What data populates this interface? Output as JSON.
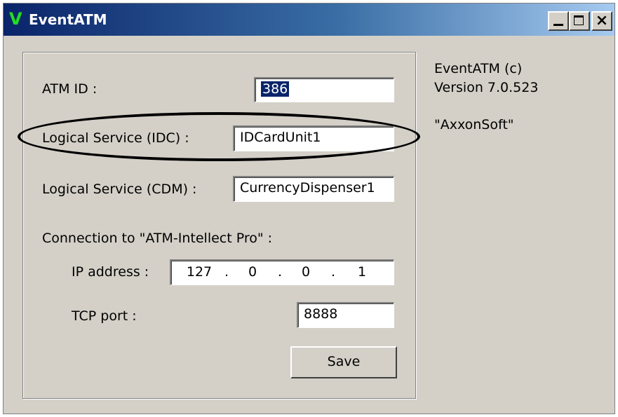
{
  "window": {
    "title": "EventATM",
    "app_icon": "V",
    "controls": {
      "minimize": "minimize-icon",
      "maximize": "maximize-icon",
      "close": "close-icon",
      "close_glyph": "×"
    }
  },
  "form": {
    "atm_id": {
      "label": "ATM ID :",
      "value": "386"
    },
    "idc": {
      "label": "Logical Service (IDC) :",
      "value": "IDCardUnit1"
    },
    "cdm": {
      "label": "Logical Service (CDM) :",
      "value": "CurrencyDispenser1"
    },
    "connection": {
      "label": "Connection to \"ATM-Intellect Pro\" :",
      "ip": {
        "label": "IP address :",
        "octets": [
          "127",
          "0",
          "0",
          "1"
        ],
        "separator": "."
      },
      "port": {
        "label": "TCP port :",
        "value": "8888"
      }
    },
    "save_label": "Save"
  },
  "info": {
    "line1": "EventATM (c)",
    "line2": "Version 7.0.523",
    "company": "\"AxxonSoft\""
  },
  "colors": {
    "title_start": "#0a246a",
    "title_end": "#a6caf0",
    "face": "#d4d0c8",
    "selection": "#0a246a",
    "icon": "#22dd22"
  }
}
